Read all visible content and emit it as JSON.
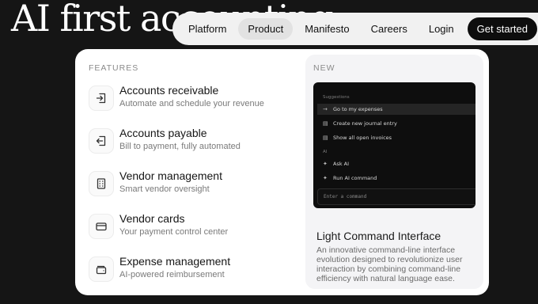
{
  "hero": {
    "title": "AI first accounting"
  },
  "nav": {
    "items": [
      "Platform",
      "Product",
      "Manifesto",
      "Careers",
      "Login"
    ],
    "active": "Product",
    "cta": "Get started"
  },
  "dropdown": {
    "features_heading": "FEATURES",
    "features": [
      {
        "icon": "arrow-in-icon",
        "title": "Accounts receivable",
        "desc": "Automate and schedule your revenue"
      },
      {
        "icon": "arrow-out-icon",
        "title": "Accounts payable",
        "desc": "Bill to payment, fully automated"
      },
      {
        "icon": "building-icon",
        "title": "Vendor management",
        "desc": "Smart vendor oversight"
      },
      {
        "icon": "card-icon",
        "title": "Vendor cards",
        "desc": "Your payment control center"
      },
      {
        "icon": "wallet-icon",
        "title": "Expense management",
        "desc": "AI-powered reimbursement"
      }
    ],
    "new_panel": {
      "label": "NEW",
      "preview": {
        "section_suggestions": "Suggestions",
        "suggestions": [
          {
            "icon": "arrow-right-icon",
            "label": "Go to my expenses"
          },
          {
            "icon": "document-icon",
            "label": "Create new journal entry"
          },
          {
            "icon": "document-icon",
            "label": "Show all open invoices"
          }
        ],
        "section_ai": "AI",
        "ai_items": [
          {
            "icon": "sparkle-icon",
            "label": "Ask AI"
          },
          {
            "icon": "sparkle-icon",
            "label": "Run AI command"
          }
        ],
        "input_placeholder": "Enter a command"
      },
      "title": "Light Command Interface",
      "desc": "An innovative command-line interface evolution designed to revolutionize user interaction by combining command-line efficiency with natural language ease."
    }
  }
}
